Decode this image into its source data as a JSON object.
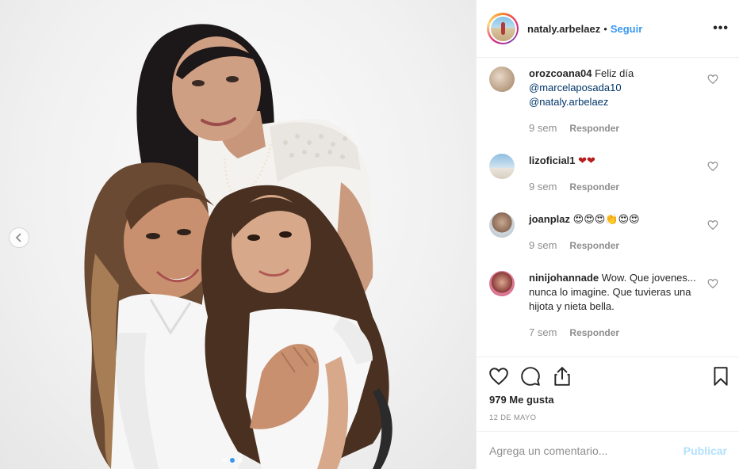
{
  "photo": {
    "description_icon": "family-portrait-photo",
    "carousel_total": 3,
    "carousel_active": 2
  },
  "header": {
    "username": "nataly.arbelaez",
    "dot": "•",
    "follow_label": "Seguir",
    "more_label": "•••"
  },
  "comments": [
    {
      "username": "orozcoana04",
      "text": "Feliz día",
      "mentions": [
        "@marcelaposada10",
        "@nataly.arbelaez"
      ],
      "time": "9 sem",
      "reply_label": "Responder"
    },
    {
      "username": "lizoficial1",
      "text": "❤❤",
      "mentions": [],
      "time": "9 sem",
      "reply_label": "Responder"
    },
    {
      "username": "joanplaz",
      "text": "😍😍😍👏😍😍",
      "mentions": [],
      "time": "9 sem",
      "reply_label": "Responder"
    },
    {
      "username": "ninijohannade",
      "text": "Wow. Que jovenes... nunca lo imagine. Que tuvieras una hijota y nieta bella.",
      "mentions": [],
      "time": "7 sem",
      "reply_label": "Responder"
    }
  ],
  "actions": {
    "likes": "979 Me gusta",
    "date": "12 DE MAYO"
  },
  "add_comment": {
    "placeholder": "Agrega un comentario...",
    "publish_label": "Publicar"
  },
  "colors": {
    "link_blue": "#3897f0",
    "mention_blue": "#003569",
    "muted_gray": "#8e8e8e",
    "publish_disabled": "#b2dffc"
  }
}
